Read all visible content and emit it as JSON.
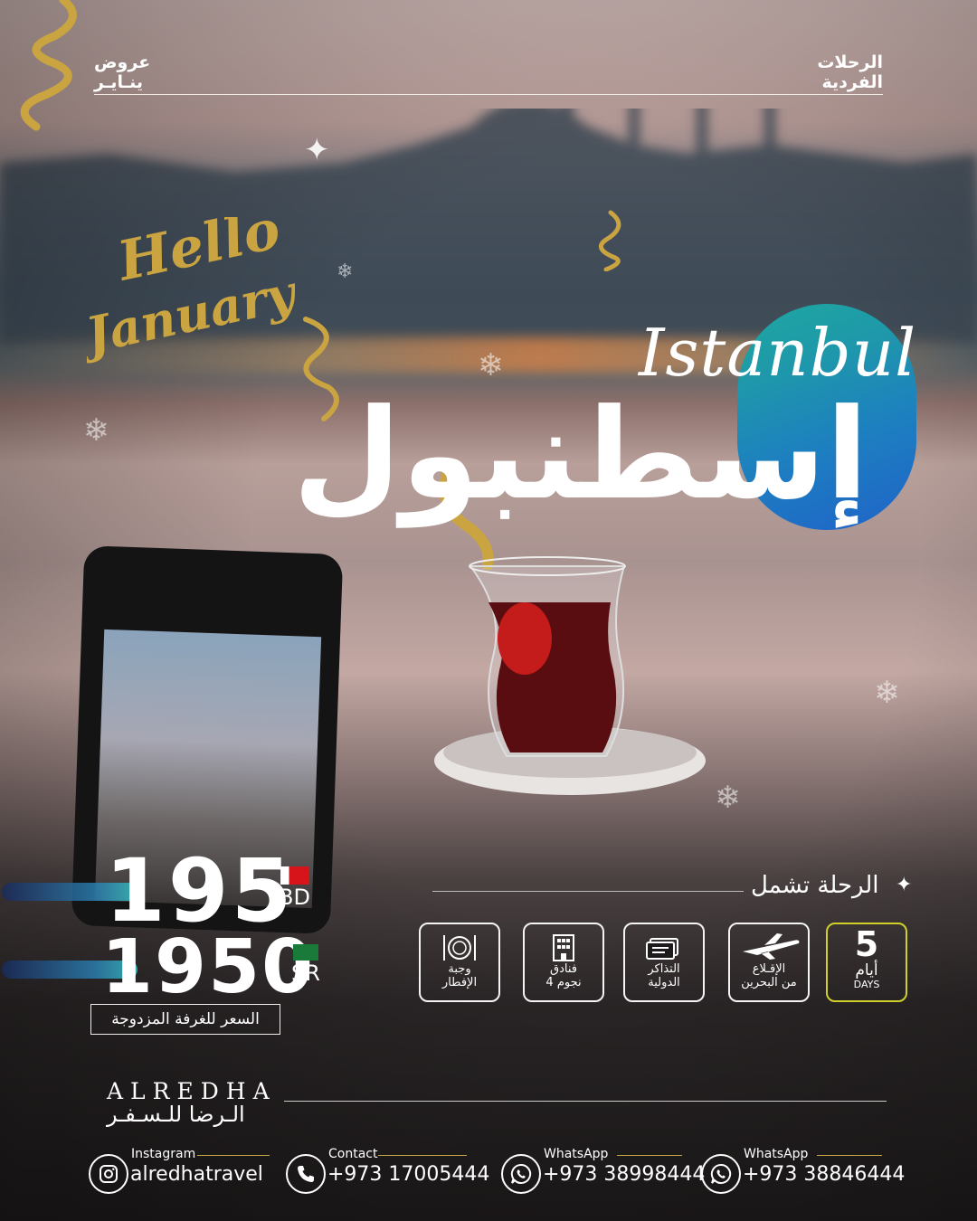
{
  "header": {
    "left_line1": "عروض",
    "left_line2": "ينـايـر",
    "right_line1": "الرحلات",
    "right_line2": "الفردية"
  },
  "greeting": {
    "line1": "Hello",
    "line2": "January"
  },
  "destination": {
    "english": "Istanbul",
    "arabic": "إسطنبول"
  },
  "pricing": {
    "bd_price": "195",
    "bd_currency": "BD",
    "sr_price": "1950",
    "sr_currency": "SR",
    "note": "السعر للغرفة المزدوجة"
  },
  "includes": {
    "title": "الرحلة تشمل",
    "items": [
      {
        "icon": "calendar-days",
        "number": "5",
        "arabic": "أيام",
        "english": "DAYS"
      },
      {
        "icon": "airplane-icon",
        "line1": "الإقـلاع",
        "line2": "من البحرين"
      },
      {
        "icon": "ticket-icon",
        "line1": "التذاكر",
        "line2": "الدولية"
      },
      {
        "icon": "hotel-icon",
        "line1": "فنادق",
        "line2": "4 نجوم"
      },
      {
        "icon": "meal-icon",
        "line1": "وجبة",
        "line2": "الإفطار"
      }
    ]
  },
  "brand": {
    "english": "ALREDHA",
    "arabic": "الـرضا للـسـفـر"
  },
  "contacts": [
    {
      "icon": "instagram-icon",
      "label": "Instagram",
      "value": "alredhatravel"
    },
    {
      "icon": "phone-icon",
      "label": "Contact",
      "value": "+973 17005444"
    },
    {
      "icon": "whatsapp-icon",
      "label": "WhatsApp",
      "value": "+973 38998444"
    },
    {
      "icon": "whatsapp-icon",
      "label": "WhatsApp",
      "value": "+973 38846444"
    }
  ],
  "colors": {
    "accent_gold": "#c9a440",
    "pill_gradient_start": "#1ea7a0",
    "pill_gradient_end": "#2063c9",
    "days_border": "#cfd12a"
  }
}
